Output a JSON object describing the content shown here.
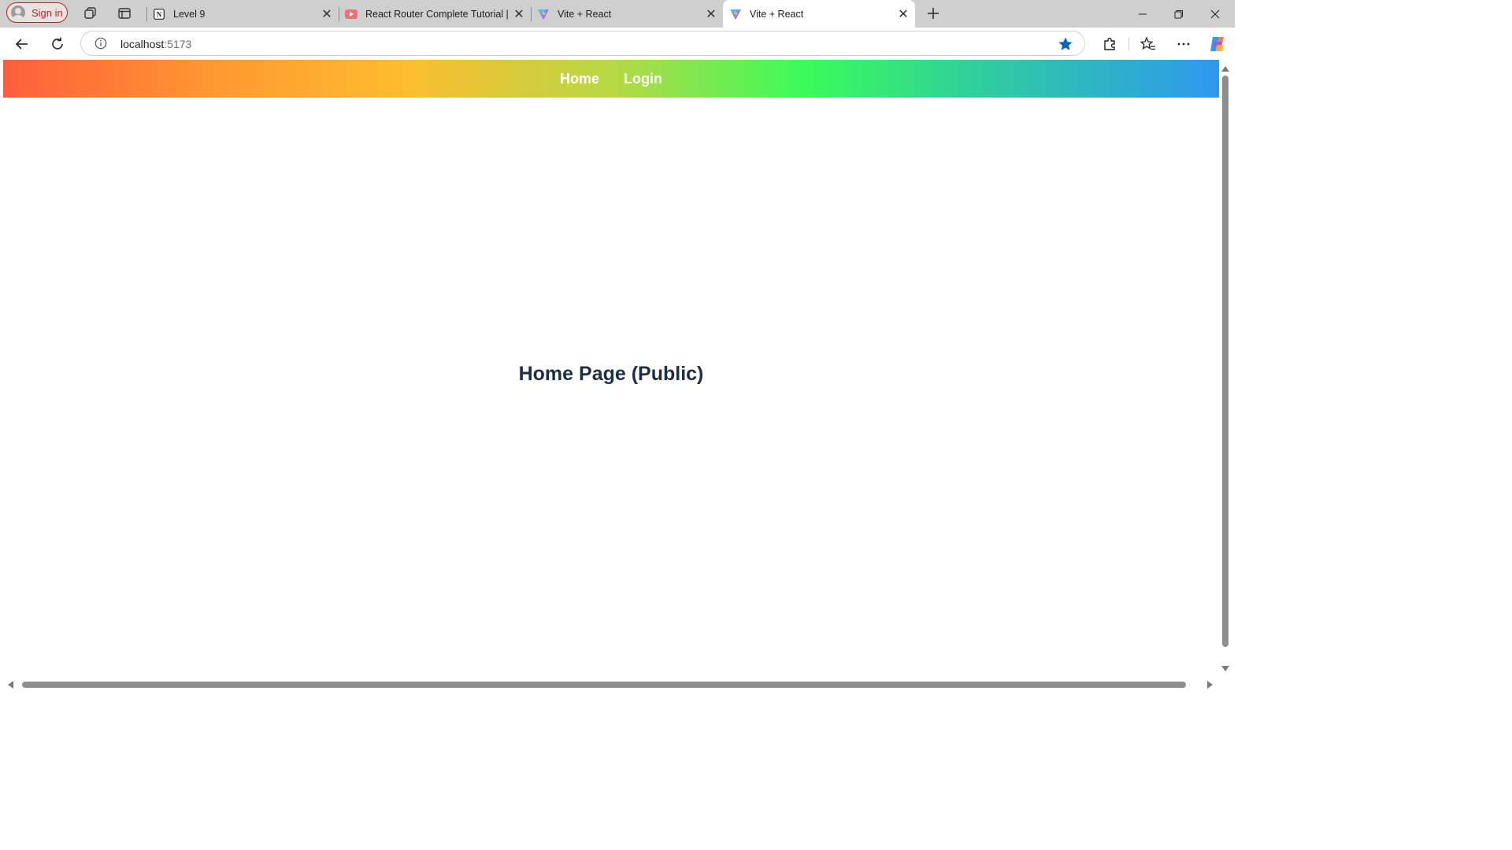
{
  "browser": {
    "profile": {
      "label": "Sign in"
    },
    "tabs": [
      {
        "title": "Level 9",
        "favicon": "notion-icon",
        "active": false
      },
      {
        "title": "React Router Complete Tutorial | R",
        "favicon": "youtube-icon",
        "active": false
      },
      {
        "title": "Vite + React",
        "favicon": "vite-icon",
        "active": false
      },
      {
        "title": "Vite + React",
        "favicon": "vite-icon",
        "active": true
      }
    ],
    "address": {
      "host": "localhost",
      "port": ":5173"
    },
    "accent_color": "#0067c0"
  },
  "page": {
    "nav": {
      "home_label": "Home",
      "login_label": "Login"
    },
    "heading": "Home Page (Public)",
    "heading_color": "#1c2f45"
  }
}
